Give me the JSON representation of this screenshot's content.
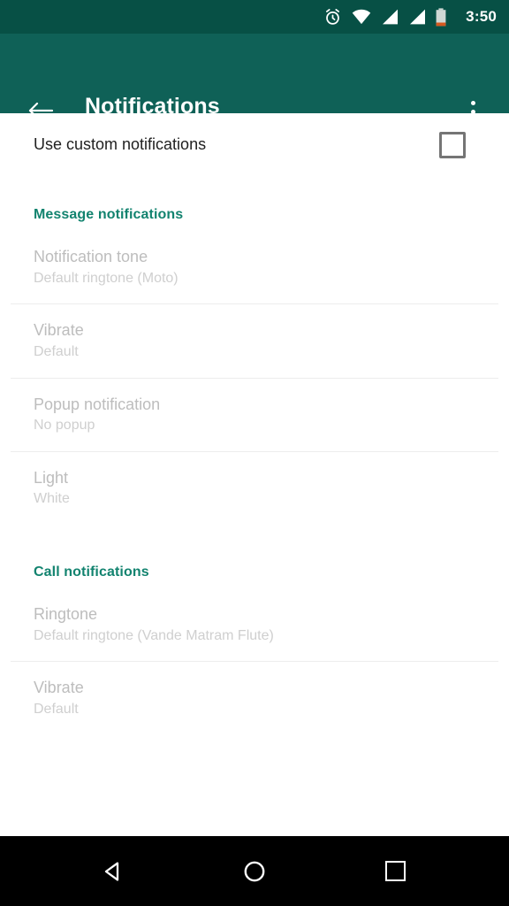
{
  "status_bar": {
    "time": "3:50",
    "icons": [
      "alarm-icon",
      "wifi-icon",
      "signal-sim1-icon",
      "signal-sim2-icon",
      "battery-icon"
    ],
    "background_color": "#075045"
  },
  "toolbar": {
    "title": "Notifications",
    "back_label": "Back",
    "overflow_label": "More options",
    "background_color": "#0f6157"
  },
  "content": {
    "custom_row": {
      "title": "Use custom notifications",
      "checked": false
    },
    "sections": [
      {
        "header": "Message notifications",
        "header_color": "#12836f",
        "items": [
          {
            "title": "Notification tone",
            "summary": "Default ringtone (Moto)"
          },
          {
            "title": "Vibrate",
            "summary": "Default"
          },
          {
            "title": "Popup notification",
            "summary": "No popup"
          },
          {
            "title": "Light",
            "summary": "White"
          }
        ]
      },
      {
        "header": "Call notifications",
        "header_color": "#12836f",
        "items": [
          {
            "title": "Ringtone",
            "summary": "Default ringtone (Vande Matram Flute)"
          },
          {
            "title": "Vibrate",
            "summary": "Default"
          }
        ]
      }
    ]
  },
  "nav_bar": {
    "back_label": "Back",
    "home_label": "Home",
    "recents_label": "Recents",
    "background_color": "#000000"
  }
}
